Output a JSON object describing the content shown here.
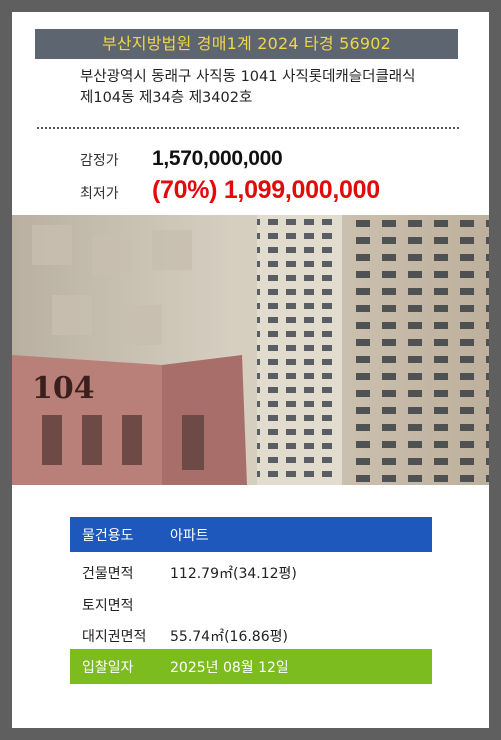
{
  "title": "부산지방법원 경매1계 2024 타경 56902",
  "address": {
    "line1": "부산광역시 동래구 사직동 1041 사직롯데캐슬더클래식",
    "line2": "제104동 제34층 제3402호"
  },
  "prices": {
    "appraisal_label": "감정가",
    "appraisal_value": "1,570,000,000",
    "minimum_label": "최저가",
    "minimum_value": "(70%) 1,099,000,000"
  },
  "photo": {
    "building_number": "104"
  },
  "details": {
    "usage_label": "물건용도",
    "usage_value": "아파트",
    "building_area_label": "건물면적",
    "building_area_value": "112.79㎡(34.12평)",
    "land_area_label": "토지면적",
    "land_area_value": "",
    "land_right_label": "대지권면적",
    "land_right_value": "55.74㎡(16.86평)",
    "bid_date_label": "입찰일자",
    "bid_date_value": "2025년 08월 12일"
  },
  "colors": {
    "title_bg": "#5d6670",
    "title_text": "#f2d44a",
    "min_price": "#e10b0b",
    "usage_bg": "#1f58bd",
    "bid_bg": "#7cbc1e"
  }
}
